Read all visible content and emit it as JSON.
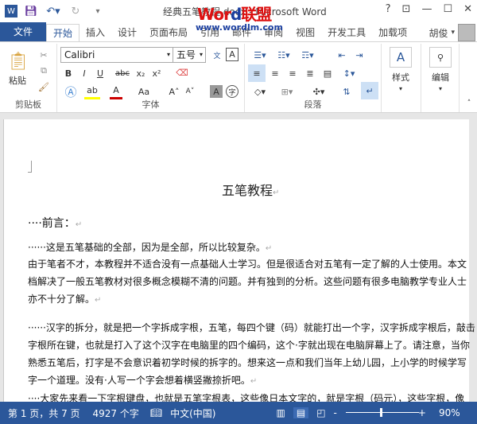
{
  "titlebar": {
    "title": "经典五笔教程.docx - Microsoft Word",
    "watermark": "Word联盟",
    "watermark_url": "www.wordlm.com",
    "help": "?",
    "restore_ribbon": "⊡",
    "minimize": "—",
    "maximize": "☐",
    "close": "✕"
  },
  "tabs": [
    {
      "label": "文件"
    },
    {
      "label": "开始"
    },
    {
      "label": "插入"
    },
    {
      "label": "设计"
    },
    {
      "label": "页面布局"
    },
    {
      "label": "引用"
    },
    {
      "label": "邮件"
    },
    {
      "label": "审阅"
    },
    {
      "label": "视图"
    },
    {
      "label": "开发工具"
    },
    {
      "label": "加载项"
    }
  ],
  "user": "胡俊",
  "ribbon": {
    "clipboard": {
      "label": "剪贴板",
      "paste": "粘贴"
    },
    "font": {
      "label": "字体",
      "font_name": "Calibri",
      "font_size": "五号",
      "bold": "B",
      "italic": "I",
      "underline": "U",
      "strike": "abc",
      "sub": "x₂",
      "sup": "x²",
      "case": "Aa",
      "grow": "A˄",
      "shrink": "A˅",
      "shade": "A",
      "enclose": "字"
    },
    "paragraph": {
      "label": "段落"
    },
    "styles": {
      "label": "样式"
    },
    "editing": {
      "label": "编辑"
    }
  },
  "document": {
    "title": "五笔教程",
    "paragraphs": [
      "····前言：",
      "······这是五笔基础的全部，因为是全部，所以比较复杂。",
      "由于笔者不才，本教程并不适合没有一点基础人士学习。但是很适合对五笔有一定了解的人士使用。本文",
      "档解决了一般五笔教材对很多概念模糊不清的问题。并有独到的分析。这些问题有很多电脑教学专业人士",
      "亦不十分了解。",
      "······汉字的拆分，就是把一个字拆成字根，五笔，每四个键（码）就能打出一个字，汉字拆成字根后，敲击",
      "字根所在键，也就是打入了这个汉字在电脑里的四个编码，这个·字就出现在电脑屏幕上了。请注意，当你",
      "熟悉五笔后，打字是不会意识着初学时候的拆字的。想来这一点和我们当年上幼儿园，上小学的时候学写",
      "字一个道理。没有·人写一个字会想着横竖撇捺折吧。",
      "····大家先来看一下字根键盘，也就是五笔字根表，这些像日本文字的，就是字根（码元），这些字根，像"
    ]
  },
  "status": {
    "page": "第 1 页，共 7 页",
    "words": "4927 个字",
    "language": "中文(中国)",
    "zoom": "90%",
    "zoom_minus": "-",
    "zoom_plus": "+"
  },
  "colors": {
    "accent": "#2b579a"
  }
}
